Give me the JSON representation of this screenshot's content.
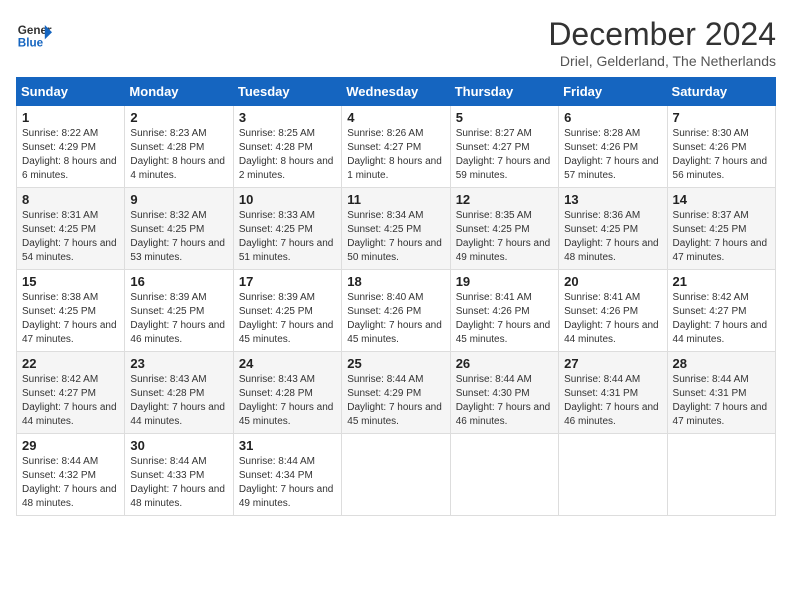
{
  "logo": {
    "line1": "General",
    "line2": "Blue"
  },
  "title": "December 2024",
  "subtitle": "Driel, Gelderland, The Netherlands",
  "days_header": [
    "Sunday",
    "Monday",
    "Tuesday",
    "Wednesday",
    "Thursday",
    "Friday",
    "Saturday"
  ],
  "weeks": [
    [
      {
        "day": "1",
        "sunrise": "Sunrise: 8:22 AM",
        "sunset": "Sunset: 4:29 PM",
        "daylight": "Daylight: 8 hours and 6 minutes."
      },
      {
        "day": "2",
        "sunrise": "Sunrise: 8:23 AM",
        "sunset": "Sunset: 4:28 PM",
        "daylight": "Daylight: 8 hours and 4 minutes."
      },
      {
        "day": "3",
        "sunrise": "Sunrise: 8:25 AM",
        "sunset": "Sunset: 4:28 PM",
        "daylight": "Daylight: 8 hours and 2 minutes."
      },
      {
        "day": "4",
        "sunrise": "Sunrise: 8:26 AM",
        "sunset": "Sunset: 4:27 PM",
        "daylight": "Daylight: 8 hours and 1 minute."
      },
      {
        "day": "5",
        "sunrise": "Sunrise: 8:27 AM",
        "sunset": "Sunset: 4:27 PM",
        "daylight": "Daylight: 7 hours and 59 minutes."
      },
      {
        "day": "6",
        "sunrise": "Sunrise: 8:28 AM",
        "sunset": "Sunset: 4:26 PM",
        "daylight": "Daylight: 7 hours and 57 minutes."
      },
      {
        "day": "7",
        "sunrise": "Sunrise: 8:30 AM",
        "sunset": "Sunset: 4:26 PM",
        "daylight": "Daylight: 7 hours and 56 minutes."
      }
    ],
    [
      {
        "day": "8",
        "sunrise": "Sunrise: 8:31 AM",
        "sunset": "Sunset: 4:25 PM",
        "daylight": "Daylight: 7 hours and 54 minutes."
      },
      {
        "day": "9",
        "sunrise": "Sunrise: 8:32 AM",
        "sunset": "Sunset: 4:25 PM",
        "daylight": "Daylight: 7 hours and 53 minutes."
      },
      {
        "day": "10",
        "sunrise": "Sunrise: 8:33 AM",
        "sunset": "Sunset: 4:25 PM",
        "daylight": "Daylight: 7 hours and 51 minutes."
      },
      {
        "day": "11",
        "sunrise": "Sunrise: 8:34 AM",
        "sunset": "Sunset: 4:25 PM",
        "daylight": "Daylight: 7 hours and 50 minutes."
      },
      {
        "day": "12",
        "sunrise": "Sunrise: 8:35 AM",
        "sunset": "Sunset: 4:25 PM",
        "daylight": "Daylight: 7 hours and 49 minutes."
      },
      {
        "day": "13",
        "sunrise": "Sunrise: 8:36 AM",
        "sunset": "Sunset: 4:25 PM",
        "daylight": "Daylight: 7 hours and 48 minutes."
      },
      {
        "day": "14",
        "sunrise": "Sunrise: 8:37 AM",
        "sunset": "Sunset: 4:25 PM",
        "daylight": "Daylight: 7 hours and 47 minutes."
      }
    ],
    [
      {
        "day": "15",
        "sunrise": "Sunrise: 8:38 AM",
        "sunset": "Sunset: 4:25 PM",
        "daylight": "Daylight: 7 hours and 47 minutes."
      },
      {
        "day": "16",
        "sunrise": "Sunrise: 8:39 AM",
        "sunset": "Sunset: 4:25 PM",
        "daylight": "Daylight: 7 hours and 46 minutes."
      },
      {
        "day": "17",
        "sunrise": "Sunrise: 8:39 AM",
        "sunset": "Sunset: 4:25 PM",
        "daylight": "Daylight: 7 hours and 45 minutes."
      },
      {
        "day": "18",
        "sunrise": "Sunrise: 8:40 AM",
        "sunset": "Sunset: 4:26 PM",
        "daylight": "Daylight: 7 hours and 45 minutes."
      },
      {
        "day": "19",
        "sunrise": "Sunrise: 8:41 AM",
        "sunset": "Sunset: 4:26 PM",
        "daylight": "Daylight: 7 hours and 45 minutes."
      },
      {
        "day": "20",
        "sunrise": "Sunrise: 8:41 AM",
        "sunset": "Sunset: 4:26 PM",
        "daylight": "Daylight: 7 hours and 44 minutes."
      },
      {
        "day": "21",
        "sunrise": "Sunrise: 8:42 AM",
        "sunset": "Sunset: 4:27 PM",
        "daylight": "Daylight: 7 hours and 44 minutes."
      }
    ],
    [
      {
        "day": "22",
        "sunrise": "Sunrise: 8:42 AM",
        "sunset": "Sunset: 4:27 PM",
        "daylight": "Daylight: 7 hours and 44 minutes."
      },
      {
        "day": "23",
        "sunrise": "Sunrise: 8:43 AM",
        "sunset": "Sunset: 4:28 PM",
        "daylight": "Daylight: 7 hours and 44 minutes."
      },
      {
        "day": "24",
        "sunrise": "Sunrise: 8:43 AM",
        "sunset": "Sunset: 4:28 PM",
        "daylight": "Daylight: 7 hours and 45 minutes."
      },
      {
        "day": "25",
        "sunrise": "Sunrise: 8:44 AM",
        "sunset": "Sunset: 4:29 PM",
        "daylight": "Daylight: 7 hours and 45 minutes."
      },
      {
        "day": "26",
        "sunrise": "Sunrise: 8:44 AM",
        "sunset": "Sunset: 4:30 PM",
        "daylight": "Daylight: 7 hours and 46 minutes."
      },
      {
        "day": "27",
        "sunrise": "Sunrise: 8:44 AM",
        "sunset": "Sunset: 4:31 PM",
        "daylight": "Daylight: 7 hours and 46 minutes."
      },
      {
        "day": "28",
        "sunrise": "Sunrise: 8:44 AM",
        "sunset": "Sunset: 4:31 PM",
        "daylight": "Daylight: 7 hours and 47 minutes."
      }
    ],
    [
      {
        "day": "29",
        "sunrise": "Sunrise: 8:44 AM",
        "sunset": "Sunset: 4:32 PM",
        "daylight": "Daylight: 7 hours and 48 minutes."
      },
      {
        "day": "30",
        "sunrise": "Sunrise: 8:44 AM",
        "sunset": "Sunset: 4:33 PM",
        "daylight": "Daylight: 7 hours and 48 minutes."
      },
      {
        "day": "31",
        "sunrise": "Sunrise: 8:44 AM",
        "sunset": "Sunset: 4:34 PM",
        "daylight": "Daylight: 7 hours and 49 minutes."
      },
      null,
      null,
      null,
      null
    ]
  ]
}
